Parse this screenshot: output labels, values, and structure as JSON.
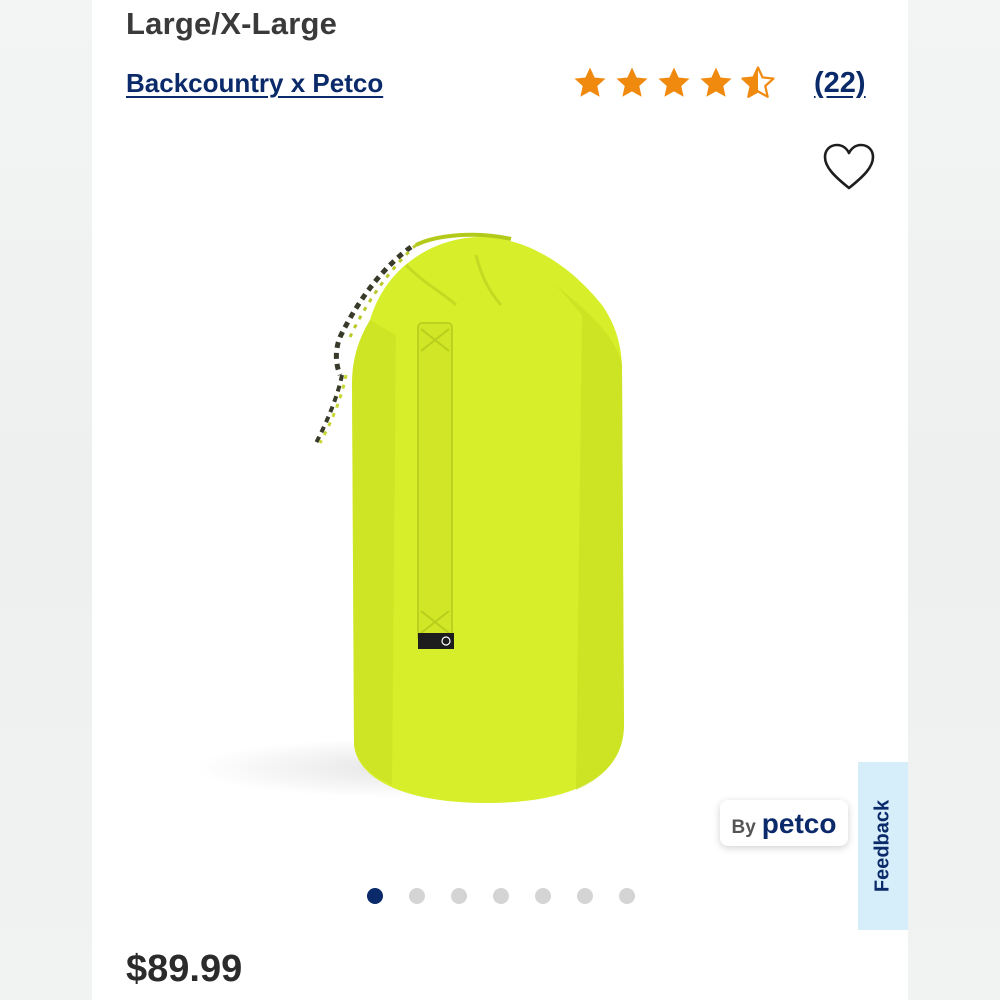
{
  "product": {
    "title": "Large/X-Large",
    "brand": "Backcountry x Petco",
    "rating": 4.5,
    "rating_max": 5,
    "review_count": "(22)",
    "price": "$89.99",
    "image_icon": "yellow-drawstring-bag"
  },
  "badge": {
    "by": "By",
    "brand": "petco"
  },
  "carousel": {
    "count": 7,
    "active_index": 0
  },
  "feedback_tab": {
    "label": "Feedback"
  },
  "colors": {
    "star": "#f08a0f",
    "brand_link": "#0b2a6a",
    "bag": "#d7ef2a",
    "dot_active": "#0b2a6a",
    "dot_inactive": "#d4d4d4",
    "feedback_bg": "#d6eef9"
  }
}
